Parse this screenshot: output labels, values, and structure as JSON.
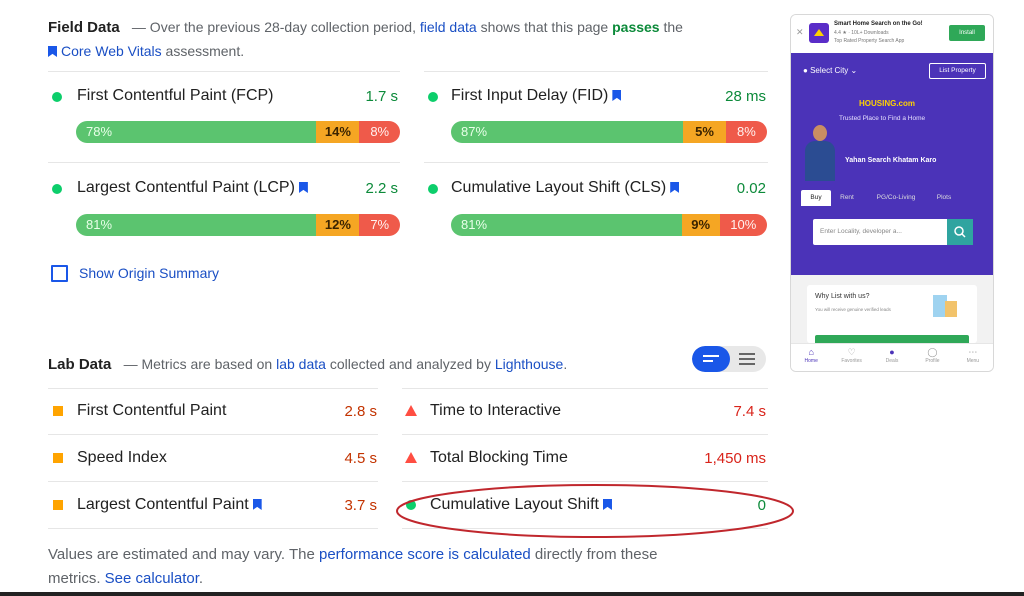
{
  "field": {
    "title": "Field Data",
    "desc_1": "— Over the previous 28-day collection period,",
    "desc_link": "field data",
    "desc_2": "shows that this page",
    "desc_pass": "passes",
    "desc_3": "the",
    "cwv_link": "Core Web Vitals",
    "cwv_tail": "assessment.",
    "metrics": [
      {
        "label": "First Contentful Paint (FCP)",
        "value": "1.7 s",
        "bar": [
          {
            "t": "78%",
            "v": 78
          },
          {
            "t": "14%",
            "v": 14
          },
          {
            "t": "8%",
            "v": 8
          }
        ]
      },
      {
        "label": "First Input Delay (FID)",
        "value": "28 ms",
        "bar": [
          {
            "t": "87%",
            "v": 87
          },
          {
            "t": "5%",
            "v": 5
          },
          {
            "t": "8%",
            "v": 8
          }
        ]
      },
      {
        "label": "Largest Contentful Paint (LCP)",
        "value": "2.2 s",
        "bar": [
          {
            "t": "81%",
            "v": 81
          },
          {
            "t": "12%",
            "v": 12
          },
          {
            "t": "7%",
            "v": 7
          }
        ]
      },
      {
        "label": "Cumulative Layout Shift (CLS)",
        "value": "0.02",
        "bar": [
          {
            "t": "81%",
            "v": 81
          },
          {
            "t": "9%",
            "v": 9
          },
          {
            "t": "10%",
            "v": 10
          }
        ]
      }
    ],
    "origin_summary": "Show Origin Summary"
  },
  "lab": {
    "title": "Lab Data",
    "desc_1": "— Metrics are based on",
    "desc_link1": "lab data",
    "desc_2": "collected and analyzed by",
    "desc_link2": "Lighthouse",
    "desc_3": ".",
    "metrics": [
      {
        "label": "First Contentful Paint",
        "value": "2.8 s",
        "marker": "square"
      },
      {
        "label": "Time to Interactive",
        "value": "7.4 s",
        "marker": "triangle"
      },
      {
        "label": "Speed Index",
        "value": "4.5 s",
        "marker": "square"
      },
      {
        "label": "Total Blocking Time",
        "value": "1,450 ms",
        "marker": "triangle"
      },
      {
        "label": "Largest Contentful Paint",
        "value": "3.7 s",
        "marker": "square"
      },
      {
        "label": "Cumulative Layout Shift",
        "value": "0",
        "marker": "circle"
      }
    ],
    "footer_1": "Values are estimated and may vary. The",
    "footer_link1": "performance score is calculated",
    "footer_2": "directly from these",
    "footer_3": "metrics.",
    "footer_link2": "See calculator",
    "footer_4": "."
  },
  "phone": {
    "ad_title": "Smart Home Search on the Go!",
    "ad_sub1": "4.4 ★ · 10L+ Downloads",
    "ad_sub2": "Top Rated Property Search App",
    "install": "Install",
    "select_city": "Select City",
    "list_property": "List Property",
    "brand": "HOUSING.com",
    "tagline": "Trusted Place to Find a Home",
    "slogan": "Yahan Search Khatam Karo",
    "tabs": [
      "Buy",
      "Rent",
      "PG/Co-Living",
      "Plots"
    ],
    "search_placeholder": "Enter Locality, developer a...",
    "why_title": "Why List with us?",
    "why_sub": "You will receive genuine verified leads",
    "nav": [
      "Home",
      "Favorites",
      "Deals",
      "Profile",
      "Menu"
    ]
  },
  "colors": {
    "pass": "#0cce6b",
    "average": "#ffa400",
    "fail": "#ff4e42",
    "link": "#1a4fc4",
    "brand": "#4b33b8",
    "annotation": "#c0272d"
  }
}
